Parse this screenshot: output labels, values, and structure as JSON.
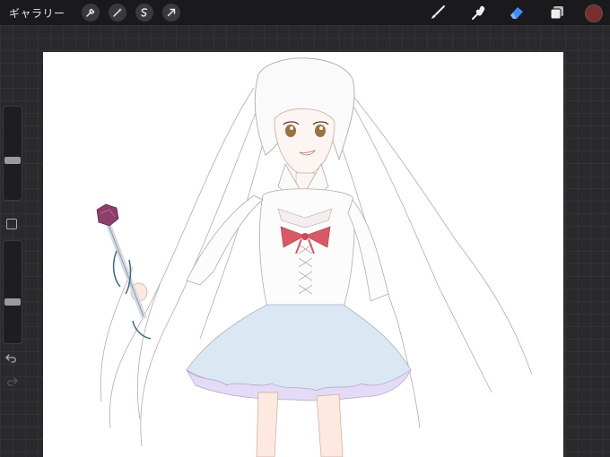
{
  "toolbar": {
    "gallery_label": "ギャラリー",
    "left_tools": [
      "wrench-icon",
      "magic-wand-icon",
      "selection-icon",
      "transform-icon"
    ],
    "right_tools": [
      "brush-icon",
      "smudge-icon",
      "eraser-icon",
      "layers-icon"
    ],
    "active_tool": "eraser-icon",
    "accent_color": "#3d8ff5",
    "current_color": "#7a2e2c"
  },
  "sidebar": {
    "brush_size_level": 0.4,
    "opacity_level": 0.38
  },
  "artwork": {
    "subject": "anime-girl-illustration",
    "skirt_color": "#dbe7f3",
    "ribbon_color": "#d85865",
    "gem_color": "#8b3f6a",
    "eye_color": "#9a7140"
  }
}
